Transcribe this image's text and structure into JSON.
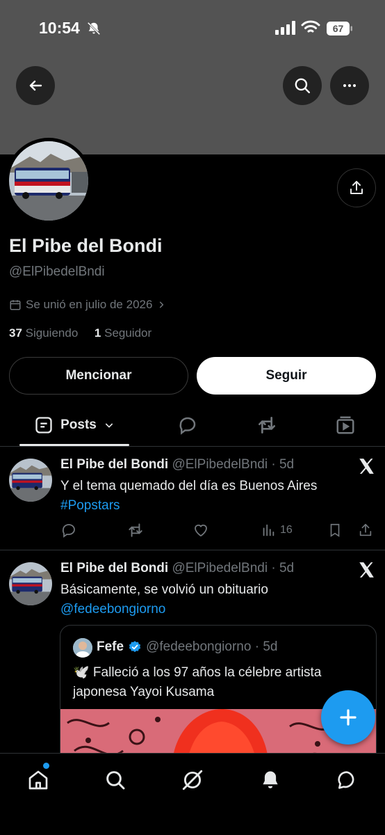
{
  "status_bar": {
    "time": "10:54",
    "battery": "67"
  },
  "profile": {
    "display_name": "El Pibe del Bondi",
    "handle": "@ElPibedelBndi",
    "joined": "Se unió en julio de 2026",
    "following_count": "37",
    "following_label": "Siguiendo",
    "followers_count": "1",
    "followers_label": "Seguidor"
  },
  "buttons": {
    "mention": "Mencionar",
    "follow": "Seguir"
  },
  "tabs": {
    "posts": "Posts"
  },
  "posts": [
    {
      "name": "El Pibe del Bondi",
      "meta": "@ElPibedelBndi · 5d",
      "text": "Y el tema quemado del día es Buenos Aires",
      "link": "#Popstars",
      "views": "16"
    },
    {
      "name": "El Pibe del Bondi",
      "meta": "@ElPibedelBndi · 5d",
      "text": "Básicamente, se volvió un obituario",
      "link": "@fedeebongiorno",
      "quote": {
        "name": "Fefe",
        "meta": "@fedeebongiorno · 5d",
        "text": "🕊️ Falleció a los 97 años la célebre artista japonesa Yayoi Kusama"
      }
    }
  ],
  "icons": {
    "back": "arrow-left-icon",
    "search": "search-icon",
    "more": "more-icon",
    "share": "share-icon",
    "calendar": "calendar-icon",
    "x_logo": "x-logo-icon",
    "verified": "verified-badge-icon",
    "nav": [
      "home-icon",
      "search-icon",
      "grok-icon",
      "bell-icon",
      "messages-icon"
    ]
  },
  "colors": {
    "accent": "#1d9bf0",
    "banner": "#535353",
    "background": "#000000",
    "muted": "#71767b"
  }
}
